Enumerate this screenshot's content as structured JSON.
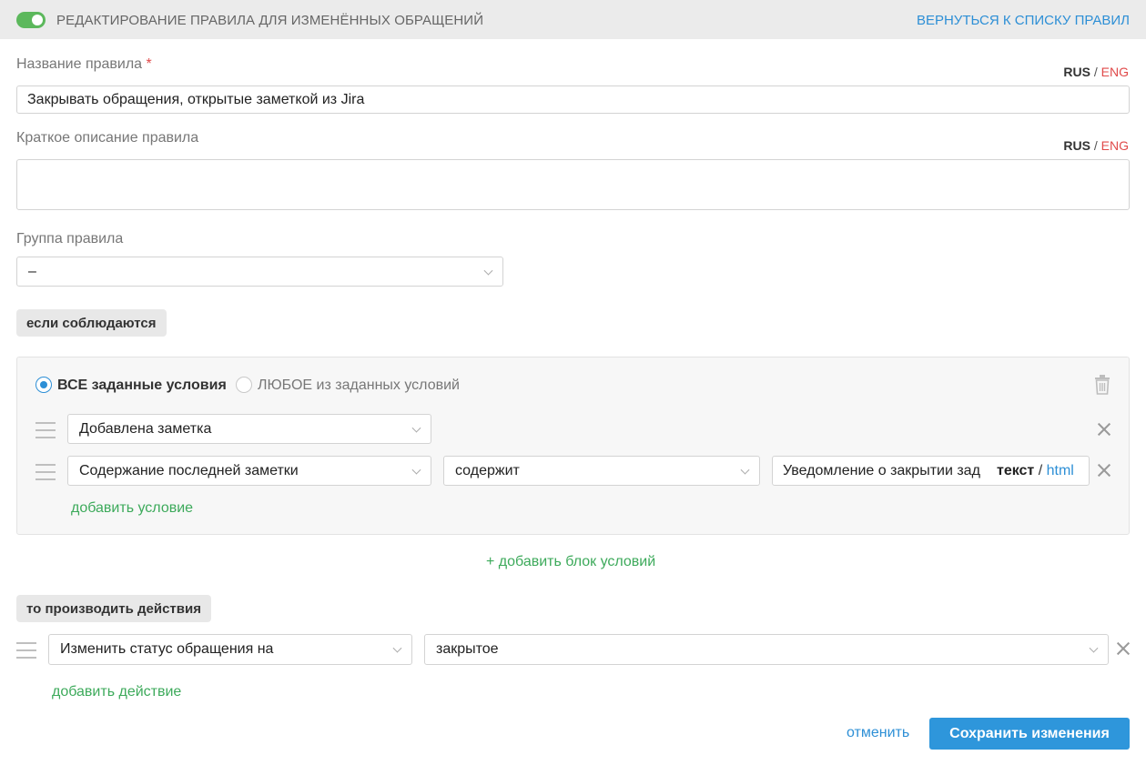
{
  "header": {
    "title": "РЕДАКТИРОВАНИЕ ПРАВИЛА ДЛЯ ИЗМЕНЁННЫХ ОБРАЩЕНИЙ",
    "back_link": "ВЕРНУТЬСЯ К СПИСКУ ПРАВИЛ",
    "enabled": true
  },
  "lang": {
    "rus": "RUS",
    "sep": "/",
    "eng": "ENG"
  },
  "rule_name": {
    "label": "Название правила",
    "required_mark": "*",
    "value": "Закрывать обращения, открытые заметкой из Jira"
  },
  "description": {
    "label": "Краткое описание правила",
    "value": ""
  },
  "group": {
    "label": "Группа правила",
    "value": "–"
  },
  "conditions": {
    "tag": "если соблюдаются",
    "mode_all": "ВСЕ заданные условия",
    "mode_any": "ЛЮБОЕ из заданных условий",
    "selected_mode": "all",
    "rows": [
      {
        "field": "Добавлена заметка"
      },
      {
        "field": "Содержание последней заметки",
        "operator": "содержит",
        "value": "Уведомление о закрытии зад",
        "format_text": "текст",
        "format_sep": "/",
        "format_html": "html"
      }
    ],
    "add_condition": "добавить условие",
    "add_block": "+ добавить блок условий"
  },
  "actions": {
    "tag": "то производить действия",
    "rows": [
      {
        "action": "Изменить статус обращения на",
        "value": "закрытое"
      }
    ],
    "add_action": "добавить действие"
  },
  "footer": {
    "cancel": "отменить",
    "save": "Сохранить изменения"
  },
  "colors": {
    "accent": "#2e96db",
    "green": "#3daa5b",
    "required": "#e04a4a",
    "toggle": "#5cb85c"
  }
}
